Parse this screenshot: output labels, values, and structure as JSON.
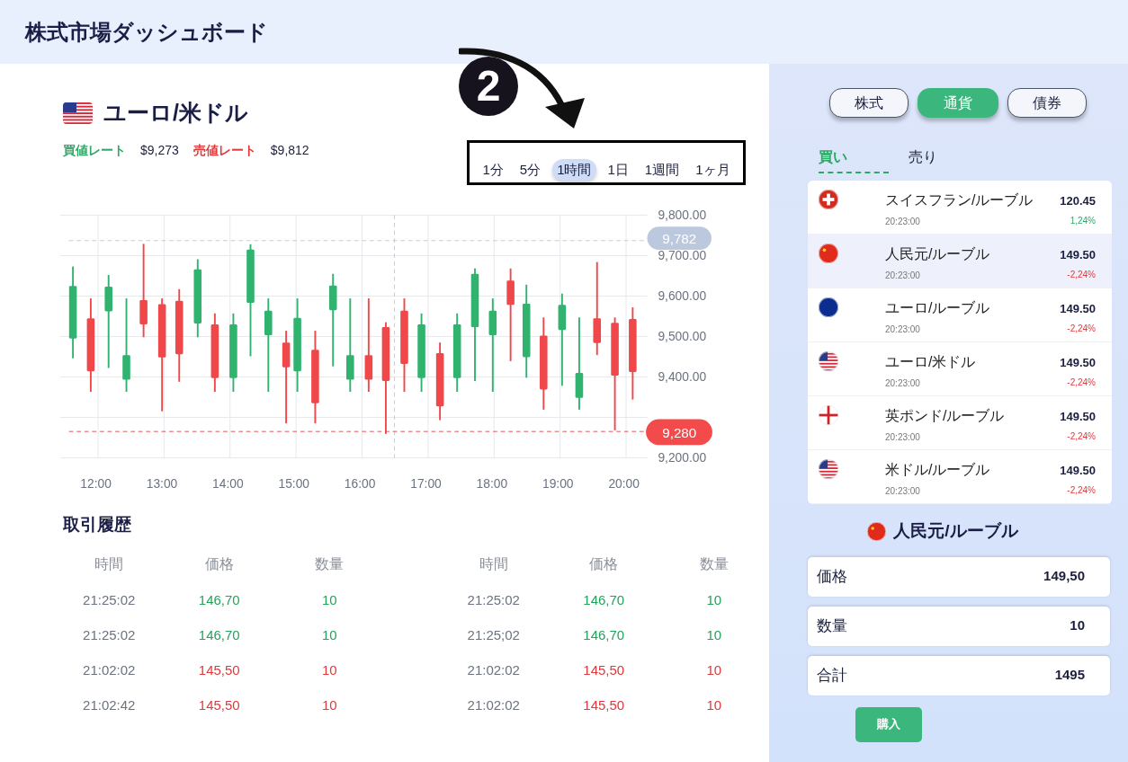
{
  "header": {
    "title": "株式市場ダッシュボード"
  },
  "instrument": {
    "title": "ユーロ/米ドル",
    "bid_label": "買値レート",
    "bid": "$9,273",
    "ask_label": "売値レート",
    "ask": "$9,812"
  },
  "annotation": {
    "step": "2"
  },
  "timeframes": [
    {
      "label": "1分",
      "selected": false
    },
    {
      "label": "5分",
      "selected": false
    },
    {
      "label": "1時間",
      "selected": true
    },
    {
      "label": "1日",
      "selected": false
    },
    {
      "label": "1週間",
      "selected": false
    },
    {
      "label": "1ヶ月",
      "selected": false
    }
  ],
  "chart": {
    "high_marker": "9,782",
    "low_marker": "9,280",
    "chart_data": {
      "type": "candlestick",
      "x": [
        11.62,
        11.89,
        12.16,
        12.43,
        12.69,
        12.97,
        13.23,
        13.51,
        13.77,
        14.05,
        14.31,
        14.58,
        14.85,
        15.02,
        15.29,
        15.56,
        15.82,
        16.1,
        16.36,
        16.64,
        16.9,
        17.18,
        17.44,
        17.71,
        17.98,
        18.25,
        18.49,
        18.75,
        19.03,
        19.29,
        19.56,
        19.83,
        20.1
      ],
      "ohlc": [
        [
          9495,
          9673,
          9446,
          9625
        ],
        [
          9545,
          9594,
          9363,
          9414
        ],
        [
          9562,
          9652,
          9422,
          9623
        ],
        [
          9393,
          9594,
          9363,
          9454
        ],
        [
          9590,
          9729,
          9498,
          9530
        ],
        [
          9580,
          9594,
          9315,
          9448
        ],
        [
          9588,
          9617,
          9388,
          9456
        ],
        [
          9532,
          9691,
          9498,
          9666
        ],
        [
          9530,
          9557,
          9363,
          9397
        ],
        [
          9397,
          9557,
          9363,
          9530
        ],
        [
          9583,
          9728,
          9451,
          9715
        ],
        [
          9503,
          9594,
          9363,
          9564
        ],
        [
          9485,
          9514,
          9285,
          9424
        ],
        [
          9414,
          9594,
          9363,
          9546
        ],
        [
          9467,
          9514,
          9285,
          9335
        ],
        [
          9565,
          9655,
          9426,
          9626
        ],
        [
          9393,
          9594,
          9363,
          9454
        ],
        [
          9454,
          9594,
          9363,
          9393
        ],
        [
          9523,
          9535,
          9259,
          9390
        ],
        [
          9564,
          9594,
          9363,
          9432
        ],
        [
          9397,
          9557,
          9363,
          9530
        ],
        [
          9459,
          9485,
          9293,
          9327
        ],
        [
          9397,
          9557,
          9363,
          9530
        ],
        [
          9523,
          9668,
          9390,
          9655
        ],
        [
          9503,
          9594,
          9363,
          9564
        ],
        [
          9638,
          9668,
          9439,
          9578
        ],
        [
          9449,
          9628,
          9398,
          9581
        ],
        [
          9502,
          9547,
          9319,
          9369
        ],
        [
          9516,
          9606,
          9378,
          9578
        ],
        [
          9348,
          9547,
          9319,
          9410
        ],
        [
          9545,
          9684,
          9454,
          9484
        ],
        [
          9534,
          9547,
          9268,
          9403
        ],
        [
          9543,
          9572,
          9344,
          9412
        ]
      ],
      "xlim": [
        11.43,
        20.32
      ],
      "ylim": [
        9200,
        9800
      ],
      "grid": true,
      "ref_lines": [
        {
          "axis": "x",
          "value": 16.49,
          "color": "#c7c9cf"
        },
        {
          "axis": "y",
          "value": 9737,
          "color": "#c7c9cf"
        },
        {
          "axis": "y",
          "value": 9265,
          "color": "#e05252"
        }
      ],
      "xticks": [
        {
          "value": 12,
          "label": "12:00"
        },
        {
          "value": 13,
          "label": "13:00"
        },
        {
          "value": 14,
          "label": "14:00"
        },
        {
          "value": 15,
          "label": "15:00"
        },
        {
          "value": 16,
          "label": "16:00"
        },
        {
          "value": 17,
          "label": "17:00"
        },
        {
          "value": 18,
          "label": "18:00"
        },
        {
          "value": 19,
          "label": "19:00"
        },
        {
          "value": 20,
          "label": "20:00"
        }
      ],
      "yticks": [
        {
          "value": 9800,
          "label": "9,800.00"
        },
        {
          "value": 9700,
          "label": "9,700.00"
        },
        {
          "value": 9600,
          "label": "9,600.00"
        },
        {
          "value": 9500,
          "label": "9,500.00"
        },
        {
          "value": 9400,
          "label": "9,400.00"
        },
        {
          "value": 9200,
          "label": "9,200.00"
        }
      ]
    }
  },
  "trade_history": {
    "title": "取引履歴",
    "tables": [
      {
        "columns": [
          "時間",
          "価格",
          "数量"
        ],
        "rows": [
          {
            "time": "21:25:02",
            "price": "146,70",
            "qty": "10",
            "color": "#22a35a"
          },
          {
            "time": "21:25:02",
            "price": "146,70",
            "qty": "10",
            "color": "#22a35a"
          },
          {
            "time": "21:02:02",
            "price": "145,50",
            "qty": "10",
            "color": "#e0393c"
          },
          {
            "time": "21:02:42",
            "price": "145,50",
            "qty": "10",
            "color": "#e0393c"
          }
        ]
      },
      {
        "columns": [
          "時間",
          "価格",
          "数量"
        ],
        "rows": [
          {
            "time": "21:25:02",
            "price": "146,70",
            "qty": "10",
            "color": "#22a35a"
          },
          {
            "time": "21:25;02",
            "price": "146,70",
            "qty": "10",
            "color": "#22a35a"
          },
          {
            "time": "21:02:02",
            "price": "145,50",
            "qty": "10",
            "color": "#e0393c"
          },
          {
            "time": "21:02:02",
            "price": "145,50",
            "qty": "10",
            "color": "#e0393c"
          }
        ]
      }
    ]
  },
  "market_tabs": [
    {
      "label": "株式",
      "selected": false
    },
    {
      "label": "通貨",
      "selected": true
    },
    {
      "label": "債券",
      "selected": false
    }
  ],
  "side_tabs": [
    {
      "label": "買い",
      "selected": true
    },
    {
      "label": "売り",
      "selected": false
    }
  ],
  "pairs": [
    {
      "kind": "ch",
      "name": "スイスフラン/ルーブル",
      "time": "20:23:00",
      "price": "120.45",
      "change": "1,24%",
      "color": "#2fa766",
      "selected": false
    },
    {
      "kind": "cn",
      "name": "人民元/ルーブル",
      "time": "20:23:00",
      "price": "149.50",
      "change": "-2,24%",
      "color": "#e0393c",
      "selected": true
    },
    {
      "kind": "eu",
      "name": "ユーロ/ルーブル",
      "time": "20:23:00",
      "price": "149.50",
      "change": "-2,24%",
      "color": "#e0393c",
      "selected": false
    },
    {
      "kind": "us",
      "name": "ユーロ/米ドル",
      "time": "20:23:00",
      "price": "149.50",
      "change": "-2,24%",
      "color": "#e0393c",
      "selected": false
    },
    {
      "kind": "en",
      "name": "英ポンド/ルーブル",
      "time": "20:23:00",
      "price": "149.50",
      "change": "-2,24%",
      "color": "#e0393c",
      "selected": false
    },
    {
      "kind": "us",
      "name": "米ドル/ルーブル",
      "time": "20:23:00",
      "price": "149.50",
      "change": "-2,24%",
      "color": "#e0393c",
      "selected": false
    }
  ],
  "order": {
    "title": "人民元/ルーブル",
    "fields": [
      {
        "label": "価格",
        "value": "149,50"
      },
      {
        "label": "数量",
        "value": "10"
      },
      {
        "label": "合計",
        "value": "1495"
      }
    ],
    "button": "購入"
  }
}
